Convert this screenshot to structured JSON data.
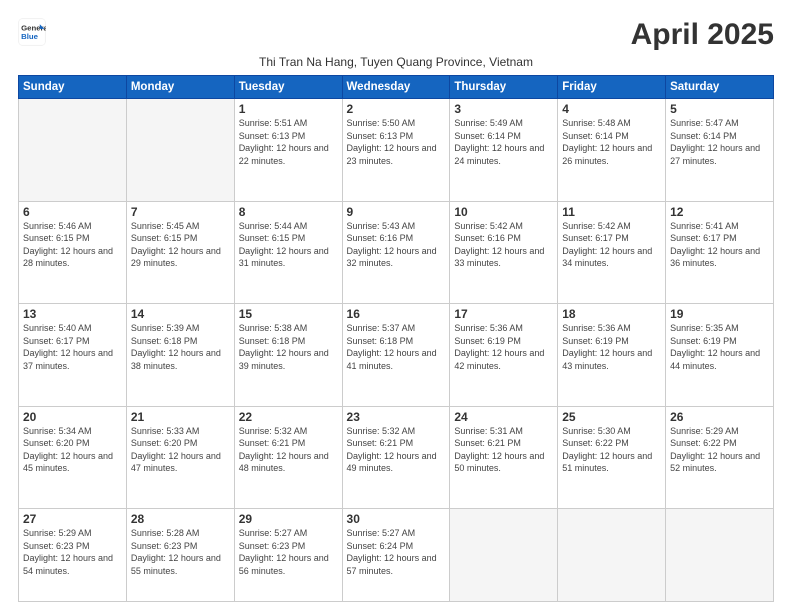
{
  "logo": {
    "line1": "General",
    "line2": "Blue"
  },
  "title": "April 2025",
  "location": "Thi Tran Na Hang, Tuyen Quang Province, Vietnam",
  "weekdays": [
    "Sunday",
    "Monday",
    "Tuesday",
    "Wednesday",
    "Thursday",
    "Friday",
    "Saturday"
  ],
  "weeks": [
    [
      {
        "day": "",
        "info": ""
      },
      {
        "day": "",
        "info": ""
      },
      {
        "day": "1",
        "info": "Sunrise: 5:51 AM\nSunset: 6:13 PM\nDaylight: 12 hours and 22 minutes."
      },
      {
        "day": "2",
        "info": "Sunrise: 5:50 AM\nSunset: 6:13 PM\nDaylight: 12 hours and 23 minutes."
      },
      {
        "day": "3",
        "info": "Sunrise: 5:49 AM\nSunset: 6:14 PM\nDaylight: 12 hours and 24 minutes."
      },
      {
        "day": "4",
        "info": "Sunrise: 5:48 AM\nSunset: 6:14 PM\nDaylight: 12 hours and 26 minutes."
      },
      {
        "day": "5",
        "info": "Sunrise: 5:47 AM\nSunset: 6:14 PM\nDaylight: 12 hours and 27 minutes."
      }
    ],
    [
      {
        "day": "6",
        "info": "Sunrise: 5:46 AM\nSunset: 6:15 PM\nDaylight: 12 hours and 28 minutes."
      },
      {
        "day": "7",
        "info": "Sunrise: 5:45 AM\nSunset: 6:15 PM\nDaylight: 12 hours and 29 minutes."
      },
      {
        "day": "8",
        "info": "Sunrise: 5:44 AM\nSunset: 6:15 PM\nDaylight: 12 hours and 31 minutes."
      },
      {
        "day": "9",
        "info": "Sunrise: 5:43 AM\nSunset: 6:16 PM\nDaylight: 12 hours and 32 minutes."
      },
      {
        "day": "10",
        "info": "Sunrise: 5:42 AM\nSunset: 6:16 PM\nDaylight: 12 hours and 33 minutes."
      },
      {
        "day": "11",
        "info": "Sunrise: 5:42 AM\nSunset: 6:17 PM\nDaylight: 12 hours and 34 minutes."
      },
      {
        "day": "12",
        "info": "Sunrise: 5:41 AM\nSunset: 6:17 PM\nDaylight: 12 hours and 36 minutes."
      }
    ],
    [
      {
        "day": "13",
        "info": "Sunrise: 5:40 AM\nSunset: 6:17 PM\nDaylight: 12 hours and 37 minutes."
      },
      {
        "day": "14",
        "info": "Sunrise: 5:39 AM\nSunset: 6:18 PM\nDaylight: 12 hours and 38 minutes."
      },
      {
        "day": "15",
        "info": "Sunrise: 5:38 AM\nSunset: 6:18 PM\nDaylight: 12 hours and 39 minutes."
      },
      {
        "day": "16",
        "info": "Sunrise: 5:37 AM\nSunset: 6:18 PM\nDaylight: 12 hours and 41 minutes."
      },
      {
        "day": "17",
        "info": "Sunrise: 5:36 AM\nSunset: 6:19 PM\nDaylight: 12 hours and 42 minutes."
      },
      {
        "day": "18",
        "info": "Sunrise: 5:36 AM\nSunset: 6:19 PM\nDaylight: 12 hours and 43 minutes."
      },
      {
        "day": "19",
        "info": "Sunrise: 5:35 AM\nSunset: 6:19 PM\nDaylight: 12 hours and 44 minutes."
      }
    ],
    [
      {
        "day": "20",
        "info": "Sunrise: 5:34 AM\nSunset: 6:20 PM\nDaylight: 12 hours and 45 minutes."
      },
      {
        "day": "21",
        "info": "Sunrise: 5:33 AM\nSunset: 6:20 PM\nDaylight: 12 hours and 47 minutes."
      },
      {
        "day": "22",
        "info": "Sunrise: 5:32 AM\nSunset: 6:21 PM\nDaylight: 12 hours and 48 minutes."
      },
      {
        "day": "23",
        "info": "Sunrise: 5:32 AM\nSunset: 6:21 PM\nDaylight: 12 hours and 49 minutes."
      },
      {
        "day": "24",
        "info": "Sunrise: 5:31 AM\nSunset: 6:21 PM\nDaylight: 12 hours and 50 minutes."
      },
      {
        "day": "25",
        "info": "Sunrise: 5:30 AM\nSunset: 6:22 PM\nDaylight: 12 hours and 51 minutes."
      },
      {
        "day": "26",
        "info": "Sunrise: 5:29 AM\nSunset: 6:22 PM\nDaylight: 12 hours and 52 minutes."
      }
    ],
    [
      {
        "day": "27",
        "info": "Sunrise: 5:29 AM\nSunset: 6:23 PM\nDaylight: 12 hours and 54 minutes."
      },
      {
        "day": "28",
        "info": "Sunrise: 5:28 AM\nSunset: 6:23 PM\nDaylight: 12 hours and 55 minutes."
      },
      {
        "day": "29",
        "info": "Sunrise: 5:27 AM\nSunset: 6:23 PM\nDaylight: 12 hours and 56 minutes."
      },
      {
        "day": "30",
        "info": "Sunrise: 5:27 AM\nSunset: 6:24 PM\nDaylight: 12 hours and 57 minutes."
      },
      {
        "day": "",
        "info": ""
      },
      {
        "day": "",
        "info": ""
      },
      {
        "day": "",
        "info": ""
      }
    ]
  ]
}
